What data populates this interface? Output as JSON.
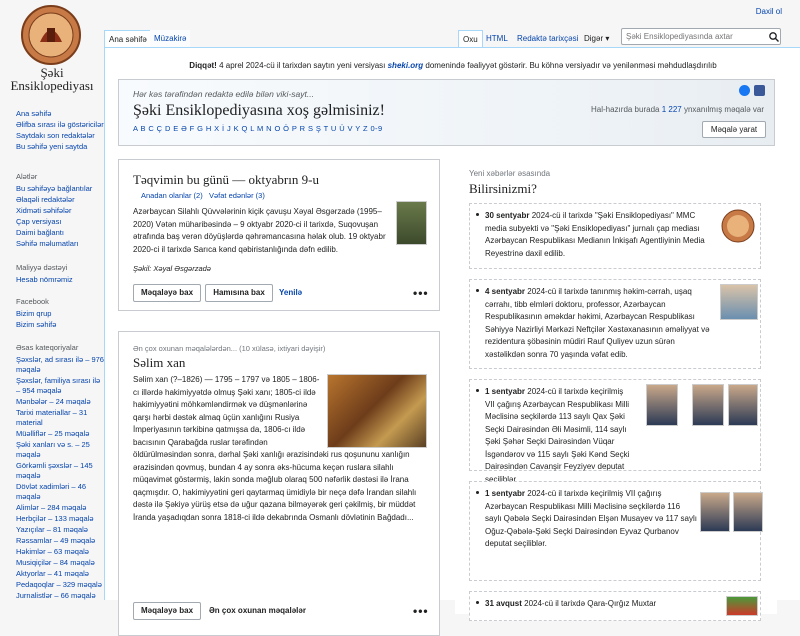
{
  "site": {
    "name_line1": "Şəki",
    "name_line2": "Ensiklopediyası"
  },
  "login": "Daxil ol",
  "tabs": {
    "main": "Ana səhifə",
    "talk": "Müzakirə",
    "read": "Oxu",
    "html": "HTML",
    "history": "Redaktə tarixçəsi",
    "more": "Digər"
  },
  "search": {
    "placeholder": "Şəki Ensiklopediyasında axtar"
  },
  "sidebar": {
    "nav": [
      "Ana səhifə",
      "Əlifba sırası ilə göstəricilər",
      "Saytdakı son redaktələr",
      "Bu səhifə yeni saytda"
    ],
    "tools_head": "Alətlər",
    "tools": [
      "Bu səhifəyə bağlantılar",
      "Əlaqəli redaktələr",
      "Xidməti səhifələr",
      "Çap versiyası",
      "Daimi bağlantı",
      "Səhifə məlumatları"
    ],
    "finance_head": "Maliyyə dəstəyi",
    "finance": [
      "Hesab nömrəmiz"
    ],
    "facebook_head": "Facebook",
    "facebook": [
      "Bizim qrup",
      "Bizim səhifə"
    ],
    "cats_head": "Əsas kateqoriyalar",
    "cats": [
      "Şəxslər, ad sırası ilə – 976 məqalə",
      "Şəxslər, familiya sırası ilə – 954 məqalə",
      "Mənbələr – 24 məqalə",
      "Tarixi materiallar – 31 material",
      "Müəlliflər – 25 məqalə",
      "Şəki xanları və s. – 25 məqalə",
      "Görkəmli şəxslər – 145 məqalə",
      "Dövlət xadimləri – 46 məqalə",
      "Alimlər – 284 məqalə",
      "Herbçilər – 133 məqalə",
      "Yazıçılar – 81 məqalə",
      "Rəssamlar – 49 məqalə",
      "Həkimlər – 63 məqalə",
      "Musiqiçilər – 84 məqalə",
      "Aktyorlar – 41 məqalə",
      "Pedaqoqlar – 329 məqalə",
      "Jurnalistlər – 66 məqalə"
    ]
  },
  "notice": {
    "bold": "Diqqət!",
    "text": " 4 aprel 2024-cü il tarixdən saytın yeni versiyası ",
    "site": "sheki.org",
    "text2": " domenində fəaliyyət göstərir. Bu köhnə versiyadır və yenilənməsi məhdudlaşdırılıb"
  },
  "banner": {
    "sub": "Hər kəs tərəfindən redaktə edilə bilən viki-sayt...",
    "title": "Şəki Ensiklopediyasına xoş gəlmisiniz!",
    "alphabet": "A B C Ç D E Ə F G H X İ J K Q L M N O Ö P R S Ş T U Ü V Y Z 0-9",
    "count_pre": "Hal-hazırda burada ",
    "count_num": "1 227",
    "count_post": " ynxanılmış məqalə var",
    "create": "Məqalə yarat"
  },
  "day": {
    "title": "Təqvimin bu günü — oktyabrın 9-u",
    "author_link1": "Anadan olanlar (2)",
    "author_link2": "Vəfat edənlər (3)",
    "text": "Azərbaycan Silahlı Qüvvələrinin kiçik çavuşu Xəyal Əsgərzadə (1995–2020) Vətən müharibəsində – 9 oktyabr 2020-ci il tarixdə, Suqovuşan ətrafında baş verən döyüşlərdə qəhrəmancasına həlak olub. 19 oktyabr 2020-ci il tarixdə Sarıca kənd qəbiristanlığında dəfn edilib.",
    "caption": "Şəkil: Xəyal Əsgərzadə",
    "btn_more": "Məqaləyə bax",
    "btn_all": "Hamısına bax",
    "refresh": "Yenilə"
  },
  "popular": {
    "sub": "Ən çox oxunan məqalələrdən... (10 xülasə, ixtiyari dəyişir)",
    "title": "Səlim xan",
    "text": "Səlim xan (?–1826) — 1795 – 1797 və 1805 – 1806-cı illərdə hakimiyyətdə olmuş Şəki xanı; 1805-ci ildə hakimiyyətini möhkəmləndirmək və düşmənlərinə qarşı hərbi dəstək almaq üçün xanlığını Rusiya İmperiyasının tərkibinə qatmışsa da, 1806-cı ildə bacısının Qarabağda ruslar tərəfindən öldürülməsindən sonra, dərhal Şəki xanlığı ərazisindəki rus qoşununu xanlığın ərazisindən qovmuş, bundan 4 ay sonra əks-hücuma keçən ruslara silahlı müqavimət göstərmiş, lakin sonda məğlub olaraq 500 nəfərlik dəstəsi ilə İrana qaçmışdır. O, hakimiyyətini geri qaytarmaq ümidiylə bir neçə dəfə İrandan silahlı dəstə ilə Şəkiyə yürüş etsə də uğur qazana bilməyərək geri çəkilmiş, bir müddət İranda yaşadıqdan sonra 1818-ci ildə dekabrında Osmanlı dövlətinin Bağdadı...",
    "btn_more": "Məqaləyə bax",
    "btn_top": "Ən çox oxunan məqalələr"
  },
  "news": {
    "sub": "Yeni xəbərlər əsasında",
    "title": "Bilirsinizmi?",
    "items": [
      {
        "date": "30 sentyabr",
        "text": " 2024-cü il tarixdə \"Şəki Ensiklopediyası\" MMC media subyekti və \"Şəki Ensiklopediyası\" jurnalı çap mediası Azərbaycan Respublikası Medianın İnkişafı Agentliyinin Media Reyestrinə daxil edilib."
      },
      {
        "date": "4 sentyabr",
        "text": " 2024-cü il tarixdə tanınmış həkim-cərrah, uşaq cərrahı, tibb elmləri doktoru, professor, Azərbaycan Respublikasının əməkdar həkimi, Azərbaycan Respublikası Səhiyyə Nazirliyi Mərkəzi Neftçilər Xəstəxanasının əməliyyat və rezidentura şöbəsinin müdiri Rauf Quliyev uzun sürən xəstəlikdən sonra 70 yaşında vəfat edib."
      },
      {
        "date": "1 sentyabr",
        "text": " 2024-cü il tarixdə keçirilmiş VII çağırış Azərbaycan Respublikası Milli Məclisinə seçkilərdə 113 saylı Qax Şəki Seçki Dairəsindən Əli Məsimli, 114 saylı Şəki Şəhər Seçki Dairəsindən Vüqar İsgəndərov və 115 saylı Şəki Kənd Seçki Dairəsindən Cavanşir Feyziyev deputat seçiliblər."
      },
      {
        "date": "1 sentyabr",
        "text": " 2024-cü il tarixdə keçirilmiş VII çağırış Azərbaycan Respublikası Milli Məclisinə seçkilərdə 116 saylı Qəbələ Seçki Dairəsindən Elşən Musayev və 117 saylı Oğuz-Qəbələ-Şəki Seçki Dairəsindən Eyvaz Qurbanov deputat seçiliblər."
      },
      {
        "date": "31 avqust",
        "text": " 2024-cü il tarixdə Qara-Qırğız Muxtar"
      }
    ]
  },
  "colors": {
    "link": "#0645ad",
    "border": "#a7d7f9",
    "bg": "#f6f6f6"
  }
}
